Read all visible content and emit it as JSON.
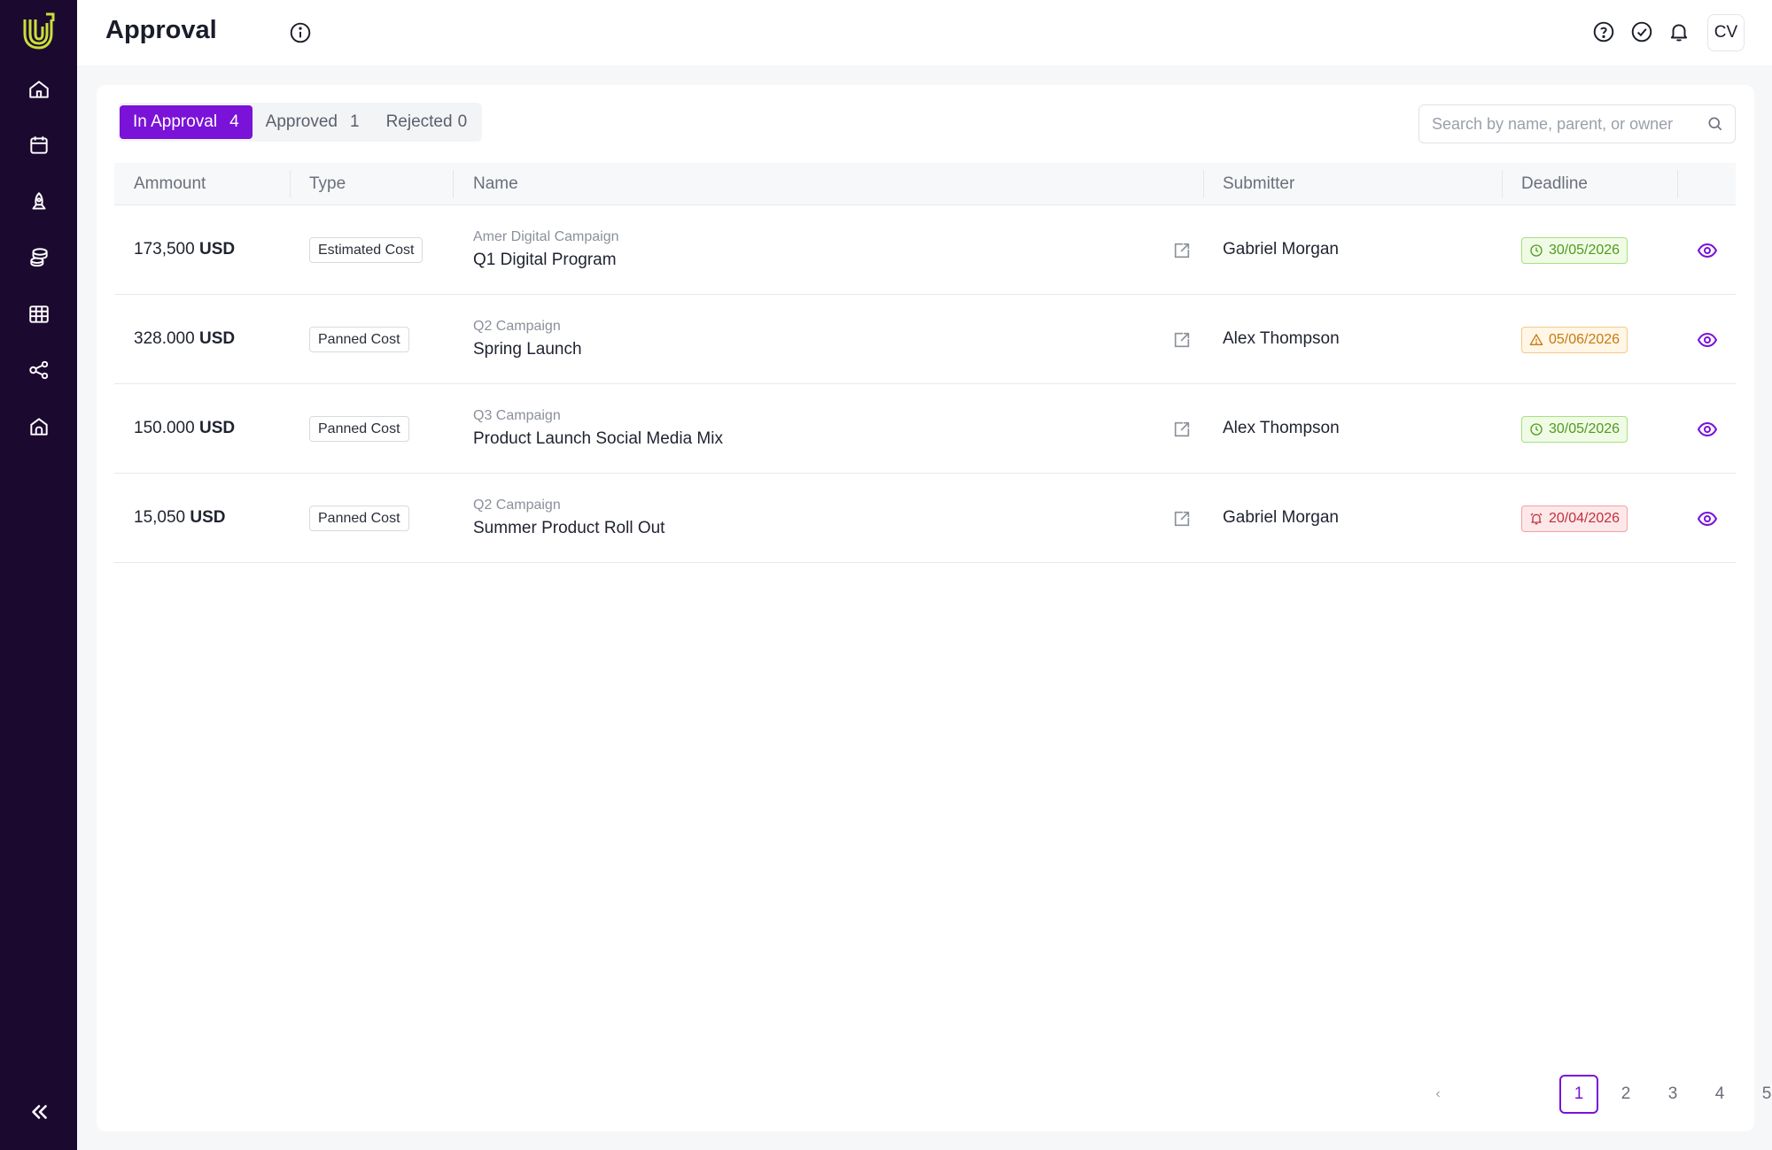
{
  "header": {
    "title": "Approval",
    "avatar_initials": "CV"
  },
  "tabs": [
    {
      "label": "In Approval",
      "count": "4"
    },
    {
      "label": "Approved",
      "count": "1"
    },
    {
      "label": "Rejected",
      "count": "0"
    }
  ],
  "search": {
    "placeholder": "Search by name, parent, or owner"
  },
  "table": {
    "columns": [
      "Ammount",
      "Type",
      "Name",
      "Submitter",
      "Deadline"
    ],
    "rows": [
      {
        "amount": "173,500",
        "currency": "USD",
        "type": "Estimated Cost",
        "parent": "Amer Digital Campaign",
        "name": "Q1 Digital Program",
        "submitter": "Gabriel Morgan",
        "deadline": "30/05/2026",
        "deadline_status": "green"
      },
      {
        "amount": "328.000",
        "currency": "USD",
        "type": "Panned Cost",
        "parent": "Q2 Campaign",
        "name": "Spring Launch",
        "submitter": "Alex Thompson",
        "deadline": "05/06/2026",
        "deadline_status": "orange"
      },
      {
        "amount": "150.000",
        "currency": "USD",
        "type": "Panned Cost",
        "parent": "Q3 Campaign",
        "name": "Product Launch Social Media Mix",
        "submitter": "Alex Thompson",
        "deadline": "30/05/2026",
        "deadline_status": "green"
      },
      {
        "amount": "15,050",
        "currency": "USD",
        "type": "Panned Cost",
        "parent": "Q2 Campaign",
        "name": "Summer Product Roll Out",
        "submitter": "Gabriel Morgan",
        "deadline": "20/04/2026",
        "deadline_status": "red"
      }
    ]
  },
  "pagination": {
    "prev": "‹",
    "next": "›",
    "pages": [
      "1",
      "2",
      "3",
      "4",
      "5"
    ],
    "current": "1"
  },
  "colors": {
    "sidebar_bg": "#1c0930",
    "accent": "#7a12d8",
    "deadline_ok": "#4e9c1d",
    "deadline_warn": "#c77a10",
    "deadline_overdue": "#c2303b"
  },
  "icons": {
    "sidebar": [
      "home-icon",
      "calendar-icon",
      "rocket-icon",
      "coins-icon",
      "grid-table-icon",
      "share-nodes-icon",
      "store-icon"
    ],
    "header": [
      "help-icon",
      "check-circle-icon",
      "bell-icon"
    ],
    "row": [
      "external-link-icon",
      "eye-icon"
    ],
    "deadline": {
      "green": "clock-icon",
      "orange": "warning-icon",
      "red": "alarm-icon"
    }
  }
}
